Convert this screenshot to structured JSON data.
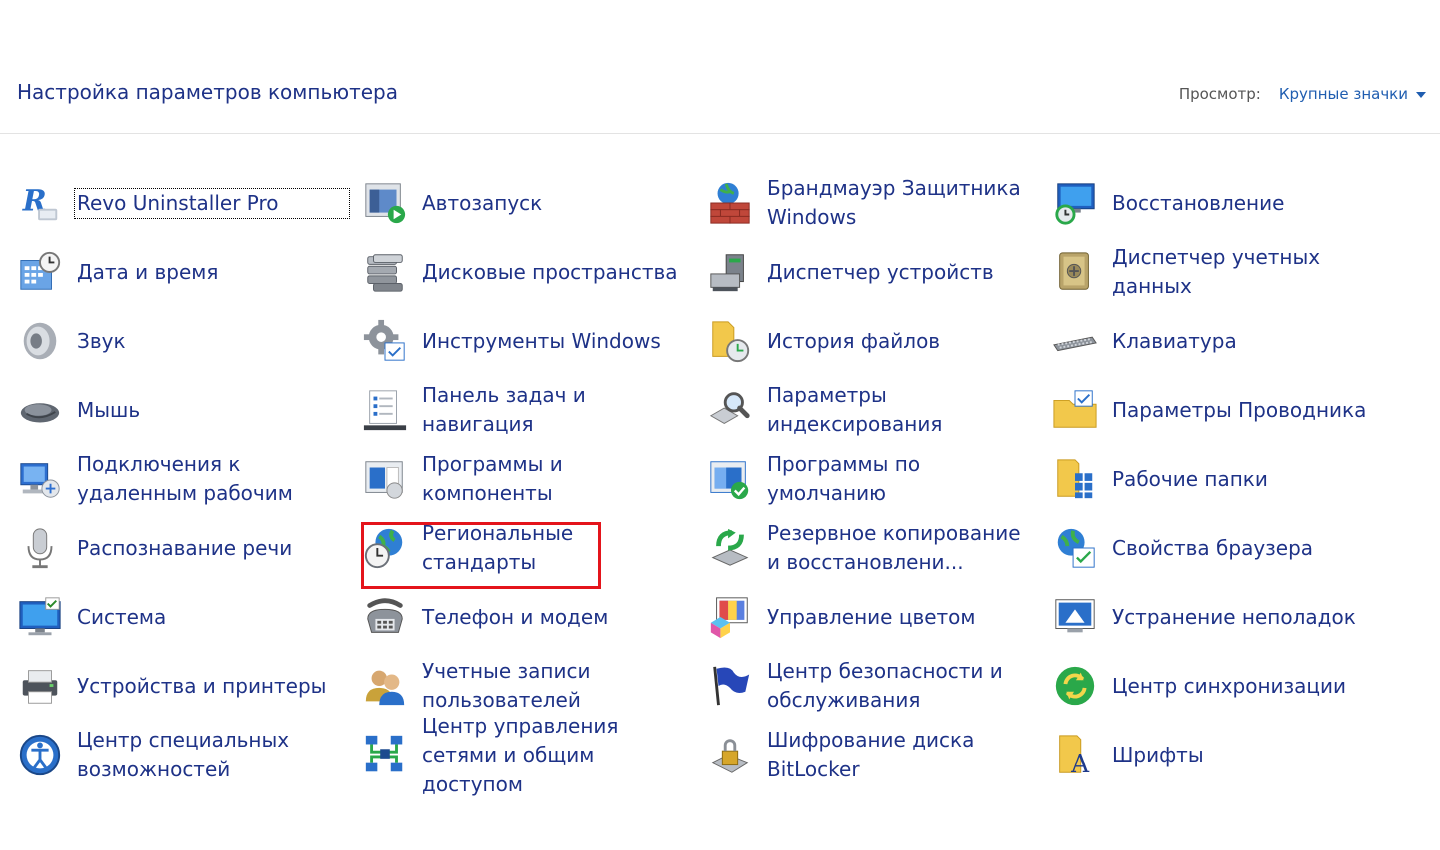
{
  "header": {
    "title": "Настройка параметров компьютера",
    "view_label": "Просмотр:",
    "view_value": "Крупные значки"
  },
  "items": [
    {
      "id": "revo",
      "label": "Revo Uninstaller Pro",
      "icon": "revo-uninstaller-icon",
      "col": 0,
      "row": 0
    },
    {
      "id": "datetime",
      "label": "Дата и время",
      "icon": "calendar-clock-icon",
      "col": 0,
      "row": 1
    },
    {
      "id": "sound",
      "label": "Звук",
      "icon": "speaker-icon",
      "col": 0,
      "row": 2
    },
    {
      "id": "mouse",
      "label": "Мышь",
      "icon": "mouse-icon",
      "col": 0,
      "row": 3
    },
    {
      "id": "remote",
      "label": "Подключения к удаленным рабочим",
      "icon": "remote-desktop-icon",
      "col": 0,
      "row": 4
    },
    {
      "id": "speech",
      "label": "Распознавание речи",
      "icon": "microphone-icon",
      "col": 0,
      "row": 5
    },
    {
      "id": "system",
      "label": "Система",
      "icon": "system-monitor-icon",
      "col": 0,
      "row": 6
    },
    {
      "id": "devices",
      "label": "Устройства и принтеры",
      "icon": "printer-icon",
      "col": 0,
      "row": 7
    },
    {
      "id": "access",
      "label": "Центр специальных возможностей",
      "icon": "accessibility-icon",
      "col": 0,
      "row": 8
    },
    {
      "id": "autoplay",
      "label": "Автозапуск",
      "icon": "autoplay-icon",
      "col": 1,
      "row": 0
    },
    {
      "id": "storage",
      "label": "Дисковые пространства",
      "icon": "storage-spaces-icon",
      "col": 1,
      "row": 1
    },
    {
      "id": "tools",
      "label": "Инструменты Windows",
      "icon": "gear-icon",
      "col": 1,
      "row": 2
    },
    {
      "id": "taskbar",
      "label": "Панель задач и навигация",
      "icon": "taskbar-icon",
      "col": 1,
      "row": 3
    },
    {
      "id": "programs",
      "label": "Программы и компоненты",
      "icon": "programs-icon",
      "col": 1,
      "row": 4
    },
    {
      "id": "region",
      "label": "Региональные стандарты",
      "icon": "globe-clock-icon",
      "col": 1,
      "row": 5
    },
    {
      "id": "phone",
      "label": "Телефон и модем",
      "icon": "phone-icon",
      "col": 1,
      "row": 6
    },
    {
      "id": "users",
      "label": "Учетные записи пользователей",
      "icon": "users-icon",
      "col": 1,
      "row": 7
    },
    {
      "id": "network",
      "label": "Центр управления сетями и общим доступом",
      "icon": "network-icon",
      "col": 1,
      "row": 8
    },
    {
      "id": "firewall",
      "label": "Брандмауэр Защитника Windows",
      "icon": "firewall-icon",
      "col": 2,
      "row": 0
    },
    {
      "id": "devmgr",
      "label": "Диспетчер устройств",
      "icon": "device-manager-icon",
      "col": 2,
      "row": 1
    },
    {
      "id": "history",
      "label": "История файлов",
      "icon": "file-history-icon",
      "col": 2,
      "row": 2
    },
    {
      "id": "indexing",
      "label": "Параметры индексирования",
      "icon": "indexing-icon",
      "col": 2,
      "row": 3
    },
    {
      "id": "defaults",
      "label": "Программы по умолчанию",
      "icon": "default-programs-icon",
      "col": 2,
      "row": 4
    },
    {
      "id": "backup",
      "label": "Резервное копирование и восстановлени...",
      "icon": "backup-icon",
      "col": 2,
      "row": 5
    },
    {
      "id": "color",
      "label": "Управление цветом",
      "icon": "color-management-icon",
      "col": 2,
      "row": 6
    },
    {
      "id": "security",
      "label": "Центр безопасности и обслуживания",
      "icon": "flag-icon",
      "col": 2,
      "row": 7
    },
    {
      "id": "bitlocker",
      "label": "Шифрование диска BitLocker",
      "icon": "bitlocker-icon",
      "col": 2,
      "row": 8
    },
    {
      "id": "recovery",
      "label": "Восстановление",
      "icon": "recovery-icon",
      "col": 3,
      "row": 0
    },
    {
      "id": "credentials",
      "label": "Диспетчер учетных данных",
      "icon": "credential-safe-icon",
      "col": 3,
      "row": 1
    },
    {
      "id": "keyboard",
      "label": "Клавиатура",
      "icon": "keyboard-icon",
      "col": 3,
      "row": 2
    },
    {
      "id": "explorer",
      "label": "Параметры Проводника",
      "icon": "folder-options-icon",
      "col": 3,
      "row": 3
    },
    {
      "id": "workfolders",
      "label": "Рабочие папки",
      "icon": "work-folders-icon",
      "col": 3,
      "row": 4
    },
    {
      "id": "browser",
      "label": "Свойства браузера",
      "icon": "internet-options-icon",
      "col": 3,
      "row": 5
    },
    {
      "id": "troubleshoot",
      "label": "Устранение неполадок",
      "icon": "troubleshooting-icon",
      "col": 3,
      "row": 6
    },
    {
      "id": "sync",
      "label": "Центр синхронизации",
      "icon": "sync-icon",
      "col": 3,
      "row": 7
    },
    {
      "id": "fonts",
      "label": "Шрифты",
      "icon": "fonts-icon",
      "col": 3,
      "row": 8
    }
  ],
  "focused_item": "revo",
  "highlighted_item": "users",
  "colors": {
    "link": "#1e3287",
    "view_link": "#1f5db0",
    "highlight": "#e4141b"
  }
}
